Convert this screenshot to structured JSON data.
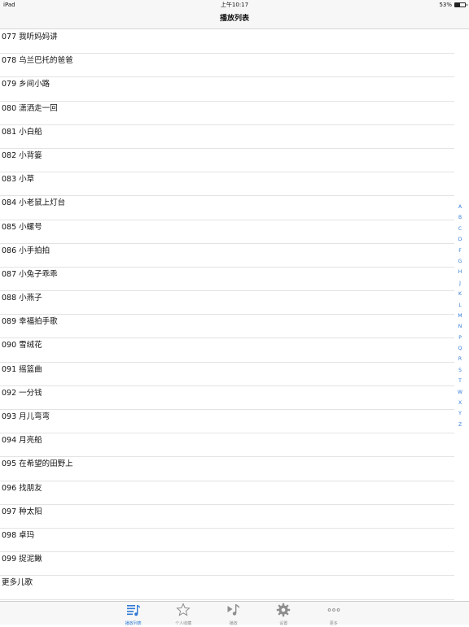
{
  "status_bar": {
    "carrier": "iPad",
    "time": "上午10:17",
    "battery_text": "53%",
    "battery_level": 0.53
  },
  "nav": {
    "title": "播放列表"
  },
  "playlist": [
    "077 我听妈妈讲",
    "078 乌兰巴托的爸爸",
    "079 乡间小路",
    "080 潇洒走一回",
    "081 小白船",
    "082 小背篓",
    "083 小草",
    "084 小老鼠上灯台",
    "085 小螺号",
    "086 小手拍拍",
    "087 小兔子乖乖",
    "088 小燕子",
    "089 幸福拍手歌",
    "090 雪绒花",
    "091 摇篮曲",
    "092 一分钱",
    "093 月儿弯弯",
    "094 月亮船",
    "095 在希望的田野上",
    "096 找朋友",
    "097 种太阳",
    "098 卓玛",
    "099 捉泥鳅",
    "更多儿歌"
  ],
  "index_letters": [
    "A",
    "B",
    "C",
    "D",
    "F",
    "G",
    "H",
    "J",
    "K",
    "L",
    "M",
    "N",
    "P",
    "Q",
    "R",
    "S",
    "T",
    "W",
    "X",
    "Y",
    "Z"
  ],
  "tabs": [
    {
      "label": "播放列表",
      "icon": "playlist-icon",
      "active": true
    },
    {
      "label": "个人收藏",
      "icon": "star-icon",
      "active": false
    },
    {
      "label": "播放",
      "icon": "play-music-icon",
      "active": false
    },
    {
      "label": "设置",
      "icon": "gear-icon",
      "active": false
    },
    {
      "label": "更多",
      "icon": "more-icon",
      "active": false
    }
  ],
  "colors": {
    "accent": "#2f7ad6",
    "inactive": "#8e8e8e"
  }
}
